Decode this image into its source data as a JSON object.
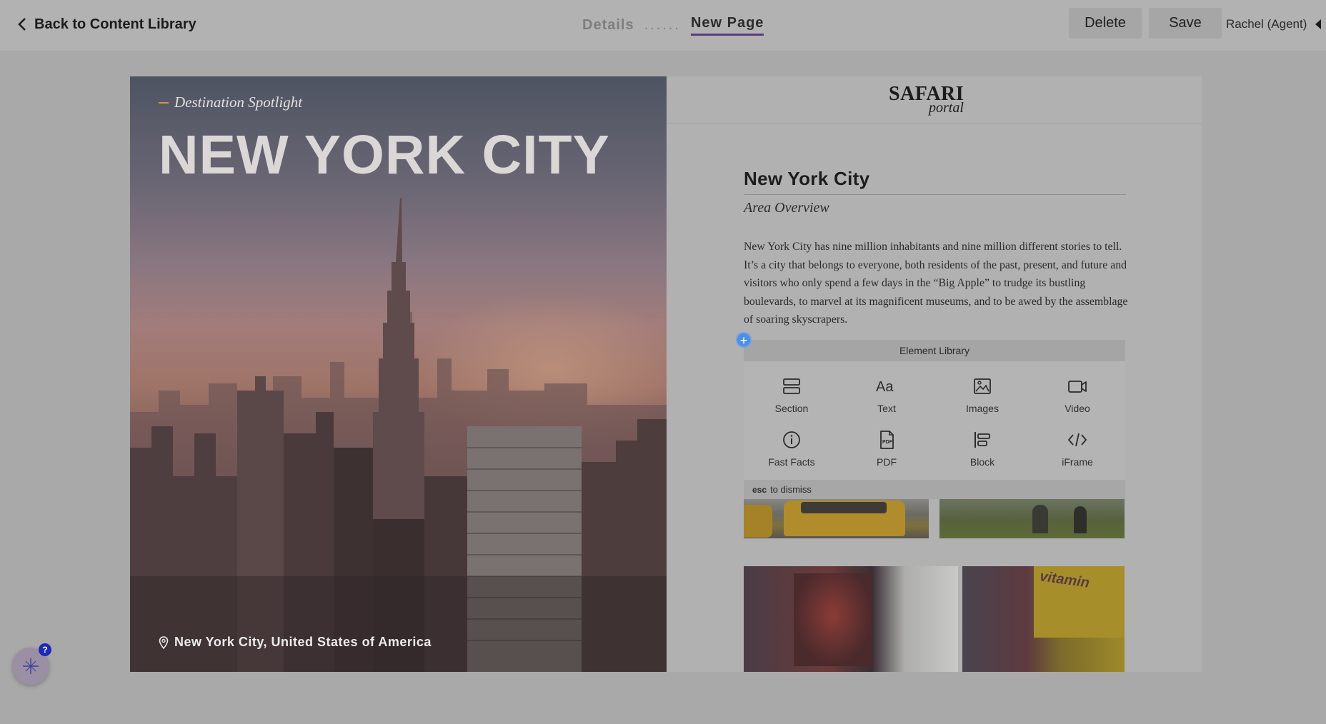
{
  "topbar": {
    "back_label": "Back to Content Library",
    "breadcrumb": {
      "details": "Details",
      "separator": "......",
      "current": "New Page"
    },
    "delete_label": "Delete",
    "save_label": "Save",
    "user_label": "Rachel (Agent)"
  },
  "hero": {
    "kicker": "Destination Spotlight",
    "title": "NEW YORK CITY",
    "location": "New York City, United States of America"
  },
  "page": {
    "logo_line1": "SAFARI",
    "logo_line2": "portal",
    "heading": "New York City",
    "subheading": "Area Overview",
    "body": "New York City has nine million inhabitants and nine million different stories to tell. It’s a city that belongs to everyone, both residents of the past, present, and future and visitors who only spend a few days in the “Big Apple” to trudge its bustling boulevards, to marvel at its magnificent museums,  and to be awed by the assemblage of soaring skyscrapers.",
    "billboard_text": "vitamin"
  },
  "element_library": {
    "add_button": "+",
    "title": "Element Library",
    "items": [
      {
        "label": "Section",
        "icon": "section-icon"
      },
      {
        "label": "Text",
        "icon": "text-icon"
      },
      {
        "label": "Images",
        "icon": "image-icon"
      },
      {
        "label": "Video",
        "icon": "video-icon"
      },
      {
        "label": "Fast Facts",
        "icon": "info-icon"
      },
      {
        "label": "PDF",
        "icon": "pdf-icon"
      },
      {
        "label": "Block",
        "icon": "block-icon"
      },
      {
        "label": "iFrame",
        "icon": "code-icon"
      }
    ],
    "dismiss_key": "esc",
    "dismiss_text": "to dismiss"
  },
  "help": {
    "badge": "?"
  },
  "colors": {
    "overlay": "#a9a9a9",
    "accent_underline": "#5c3b7c",
    "add_button": "#4f8fe0",
    "help_badge": "#1c2ab5",
    "kicker_dash": "#d49a3a"
  }
}
